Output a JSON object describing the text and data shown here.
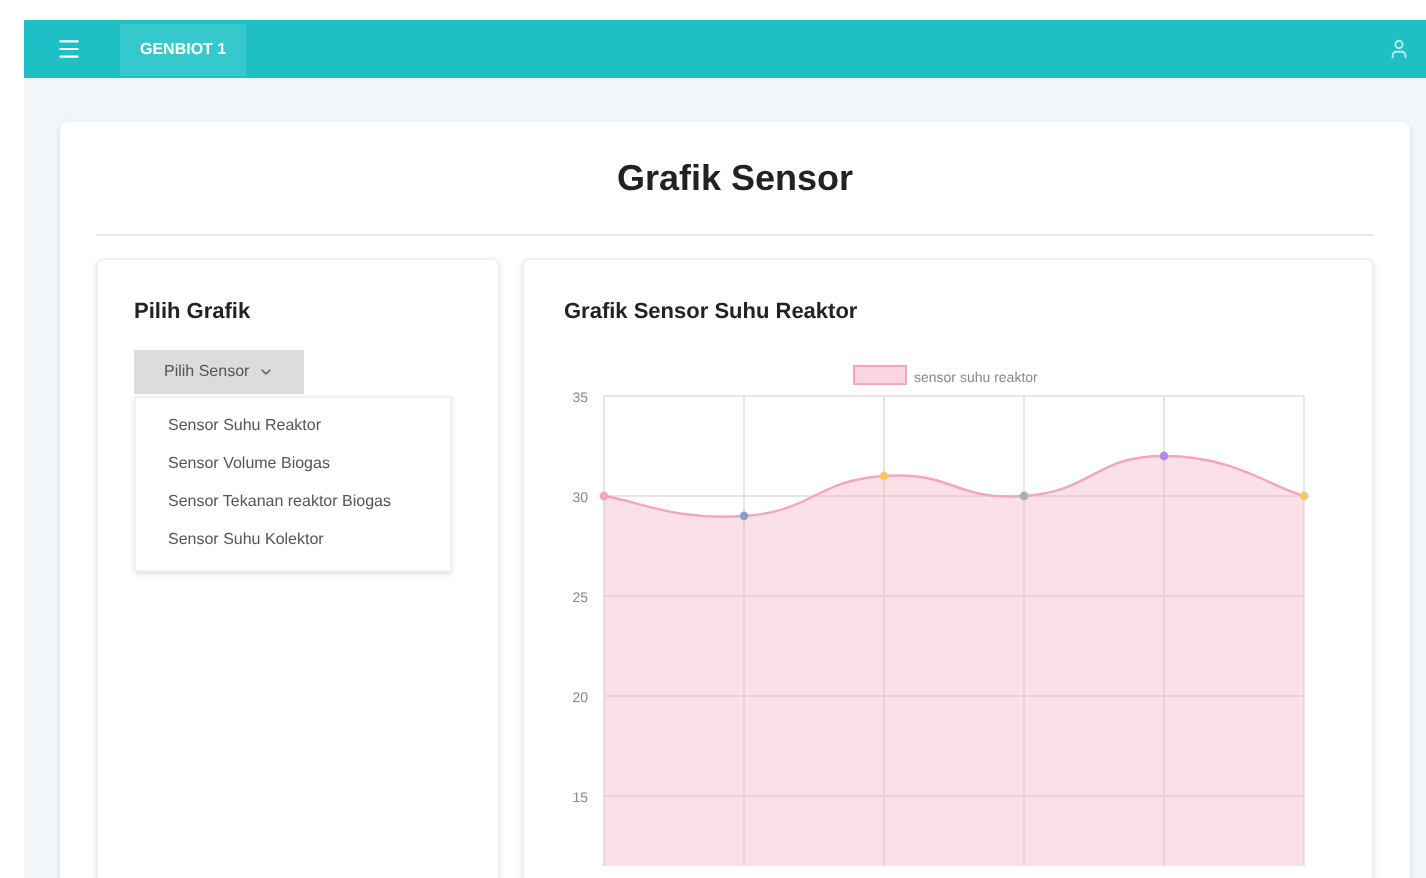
{
  "navbar": {
    "brand": "GENBIOT 1"
  },
  "page": {
    "title": "Grafik Sensor"
  },
  "selector": {
    "title": "Pilih Grafik",
    "button": "Pilih Sensor",
    "options": [
      "Sensor Suhu Reaktor",
      "Sensor Volume Biogas",
      "Sensor Tekanan reaktor Biogas",
      "Sensor Suhu Kolektor"
    ]
  },
  "chart_panel": {
    "title": "Grafik Sensor Suhu Reaktor",
    "chart_data": {
      "type": "area",
      "ylim": [
        11.5,
        35
      ],
      "yticks": [
        15,
        20,
        25,
        30,
        35
      ],
      "grid": true,
      "series": [
        {
          "name": "sensor suhu reaktor",
          "color": "#f4a6ba",
          "values": [
            30,
            29,
            31,
            30,
            32,
            30
          ]
        }
      ]
    }
  }
}
